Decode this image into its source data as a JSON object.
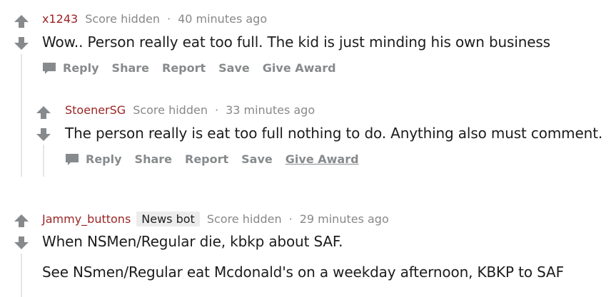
{
  "comments": [
    {
      "author": "x1243",
      "score": "Score hidden",
      "separator": "·",
      "time": "40 minutes ago",
      "body": "Wow.. Person really eat too full. The kid is just minding his own business",
      "actions": [
        "Reply",
        "Share",
        "Report",
        "Save",
        "Give Award"
      ]
    },
    {
      "author": "StoenerSG",
      "score": "Score hidden",
      "separator": "·",
      "time": "33 minutes ago",
      "body": "The person really is eat too full nothing to do. Anything also must comment.",
      "actions": [
        "Reply",
        "Share",
        "Report",
        "Save",
        "Give Award"
      ]
    },
    {
      "author": "Jammy_buttons",
      "flair": "News bot",
      "score": "Score hidden",
      "separator": "·",
      "time": "29 minutes ago",
      "body": "When NSMen/Regular die, kbkp about SAF.",
      "body2": "See NSmen/Regular eat Mcdonald's on a weekday afternoon, KBKP to SAF"
    }
  ],
  "colors": {
    "author": "#9b2424",
    "meta": "#888888",
    "action": "#878a8c",
    "arrow": "#878a8c",
    "thread_line": "#e6e6e6"
  },
  "icons": {
    "upvote": "arrow-up-icon",
    "downvote": "arrow-down-icon",
    "reply": "speech-bubble-icon"
  }
}
